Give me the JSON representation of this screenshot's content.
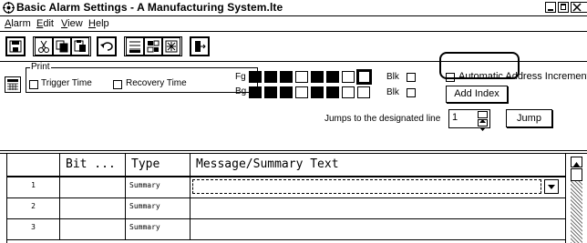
{
  "window": {
    "title": "Basic Alarm Settings - A Manufacturing System.lte"
  },
  "menu": {
    "items": [
      {
        "accel": "A",
        "rest": "larm"
      },
      {
        "accel": "E",
        "rest": "dit"
      },
      {
        "accel": "V",
        "rest": "iew"
      },
      {
        "accel": "H",
        "rest": "elp"
      }
    ]
  },
  "toolbar": {
    "icons": [
      "save-icon",
      "cut-icon",
      "copy-icon",
      "paste-icon",
      "undo-icon",
      "insert-row-icon",
      "delete-row-icon",
      "style-icon",
      "open-icon"
    ]
  },
  "print_group": {
    "label": "Print",
    "trigger_time": "Trigger Time",
    "recovery_time": "Recovery Time"
  },
  "colors": {
    "fg_label": "Fg",
    "bg_label": "Bg",
    "blink_label": "Blk",
    "fg_swatches": [
      "black",
      "black",
      "black",
      "white",
      "black",
      "black",
      "white",
      "black-selected"
    ],
    "bg_swatches": [
      "black",
      "black",
      "black",
      "white",
      "black",
      "black",
      "white",
      "white"
    ]
  },
  "auto_address": {
    "label": "Automatic Address Increment",
    "checked": false
  },
  "add_index_button": "Add Index",
  "jump": {
    "label": "Jumps to the designated line",
    "value": "1",
    "button": "Jump"
  },
  "table": {
    "headers": [
      "",
      "Bit ...",
      "Type",
      "Message/Summary Text"
    ],
    "rows": [
      {
        "num": "1",
        "bit": "",
        "type": "Summary",
        "text": ""
      },
      {
        "num": "2",
        "bit": "",
        "type": "Summary",
        "text": ""
      },
      {
        "num": "3",
        "bit": "",
        "type": "Summary",
        "text": ""
      }
    ]
  }
}
